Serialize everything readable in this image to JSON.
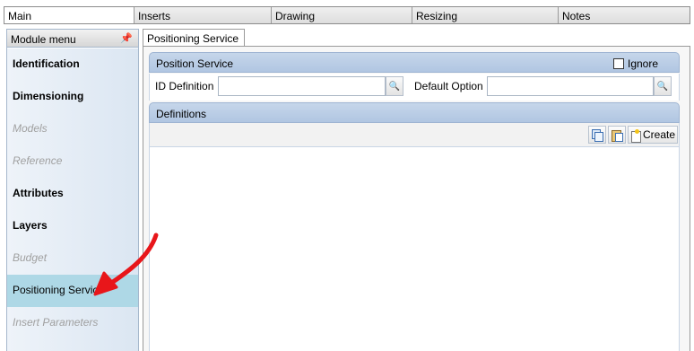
{
  "top_tabs": [
    {
      "label": "Main",
      "active": true
    },
    {
      "label": "Inserts",
      "active": false
    },
    {
      "label": "Drawing",
      "active": false
    },
    {
      "label": "Resizing",
      "active": false
    },
    {
      "label": "Notes",
      "active": false
    }
  ],
  "module_menu": {
    "title": "Module menu",
    "pin_icon": "pin-icon",
    "items": [
      {
        "label": "Identification",
        "style": "bold"
      },
      {
        "label": "Dimensioning",
        "style": "bold"
      },
      {
        "label": "Models",
        "style": "disabled"
      },
      {
        "label": "Reference",
        "style": "disabled"
      },
      {
        "label": "Attributes",
        "style": "bold"
      },
      {
        "label": "Layers",
        "style": "bold"
      },
      {
        "label": "Budget",
        "style": "disabled"
      },
      {
        "label": "Positioning Service",
        "style": "selected"
      },
      {
        "label": "Insert Parameters",
        "style": "disabled"
      }
    ]
  },
  "content": {
    "tab_label": "Positioning Service",
    "position_service": {
      "title": "Position Service",
      "ignore_label": "Ignore",
      "ignore_checked": false,
      "id_definition_label": "ID Definition",
      "id_definition_value": "",
      "default_option_label": "Default Option",
      "default_option_value": ""
    },
    "definitions": {
      "title": "Definitions",
      "create_label": "Create",
      "toolbar_icons": [
        "copy-icon",
        "paste-icon",
        "new-document-icon"
      ]
    }
  },
  "annotation": {
    "arrow_color": "#e8161a"
  },
  "colors": {
    "selected_item": "#aed8e6",
    "section_bar": "#b9cbe4"
  }
}
